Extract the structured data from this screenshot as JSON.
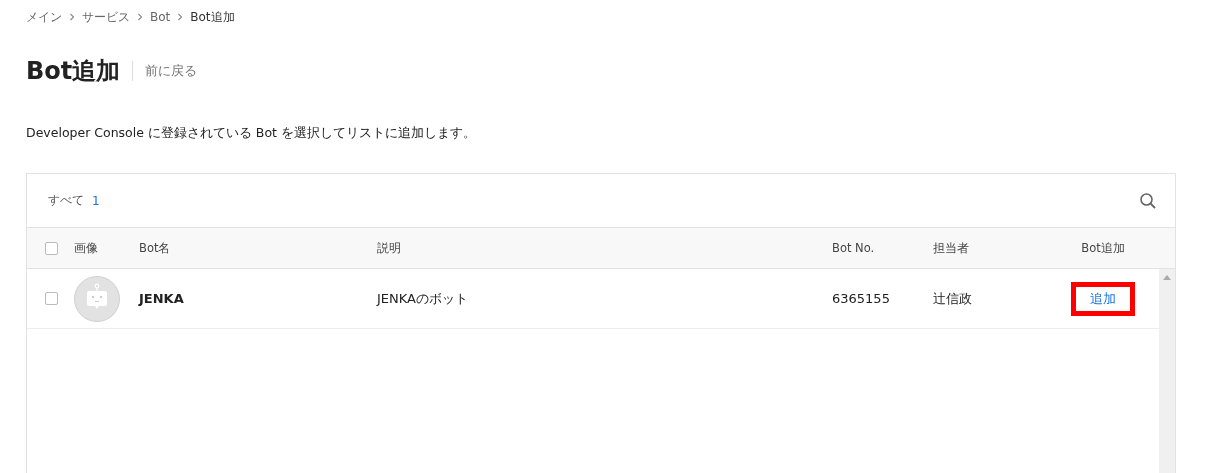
{
  "breadcrumb": [
    {
      "label": "メイン",
      "current": false
    },
    {
      "label": "サービス",
      "current": false
    },
    {
      "label": "Bot",
      "current": false
    },
    {
      "label": "Bot追加",
      "current": true
    }
  ],
  "title": "Bot追加",
  "back_link": "前に戻る",
  "description": "Developer Console に登録されている Bot を選択してリストに追加します。",
  "table": {
    "filter_label": "すべて",
    "count": "1",
    "columns": [
      "画像",
      "Bot名",
      "説明",
      "Bot No.",
      "担当者",
      "Bot追加"
    ],
    "select_all_checked": false,
    "rows": [
      {
        "checked": false,
        "name": "JENKA",
        "description": "JENKAのボット",
        "bot_no": "6365155",
        "manager": "辻信政",
        "action": "追加",
        "highlighted": true
      }
    ]
  }
}
